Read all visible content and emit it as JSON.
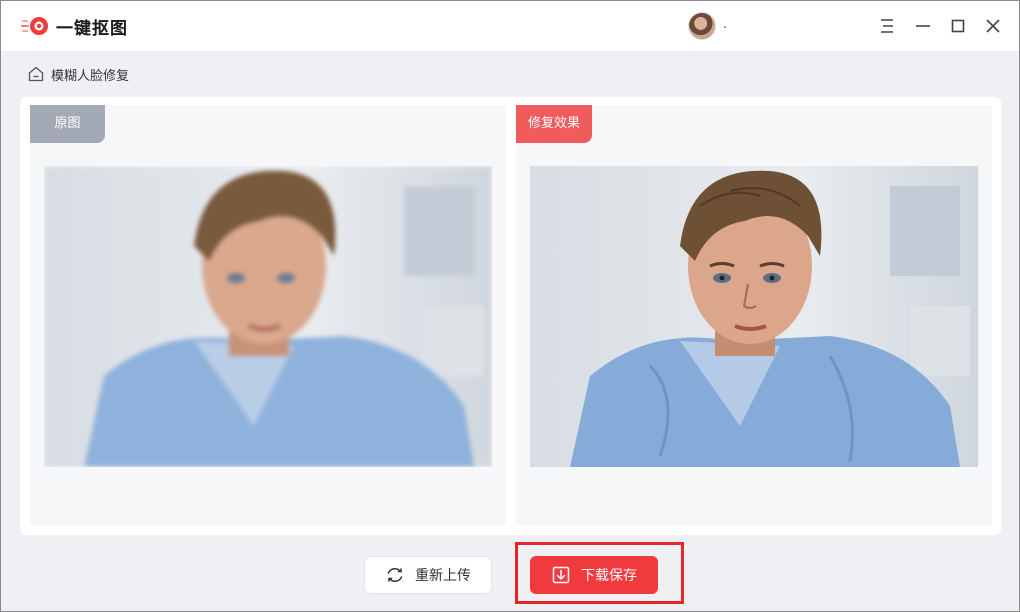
{
  "app": {
    "title": "一键抠图"
  },
  "user": {
    "name": "."
  },
  "breadcrumb": {
    "label": "模糊人脸修复"
  },
  "panes": {
    "original_label": "原图",
    "result_label": "修复效果"
  },
  "actions": {
    "reupload_label": "重新上传",
    "save_label": "下载保存"
  },
  "colors": {
    "accent": "#f03a3e",
    "original_tag": "#a4a9b6",
    "result_tag": "#f05b5b",
    "highlight": "#e8262a"
  }
}
